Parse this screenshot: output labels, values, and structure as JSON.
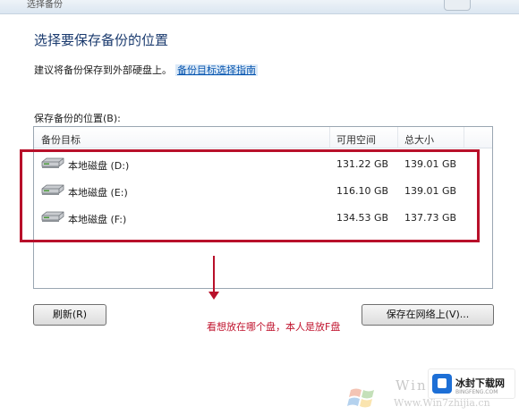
{
  "window": {
    "title_fragment": "选择备份"
  },
  "heading": "选择要保存备份的位置",
  "advice": {
    "text": "建议将备份保存到外部硬盘上。",
    "link": "备份目标选择指南"
  },
  "list": {
    "label": "保存备份的位置(B):",
    "columns": {
      "name": "备份目标",
      "free": "可用空间",
      "total": "总大小"
    },
    "rows": [
      {
        "name": "本地磁盘 (D:)",
        "free": "131.22 GB",
        "total": "139.01 GB"
      },
      {
        "name": "本地磁盘 (E:)",
        "free": "116.10 GB",
        "total": "139.01 GB"
      },
      {
        "name": "本地磁盘 (F:)",
        "free": "134.53 GB",
        "total": "137.73 GB"
      }
    ]
  },
  "annotation": {
    "note": "看想放在哪个盘，本人是放F盘",
    "color": "#b8102a"
  },
  "buttons": {
    "refresh": "刷新(R)",
    "save_network": "保存在网络上(V)..."
  },
  "watermark": {
    "text": "Win7",
    "url": "Www.Win7zhijia.cn",
    "badge_name": "冰封下载网",
    "badge_sub": "BINGFENG.COM"
  }
}
